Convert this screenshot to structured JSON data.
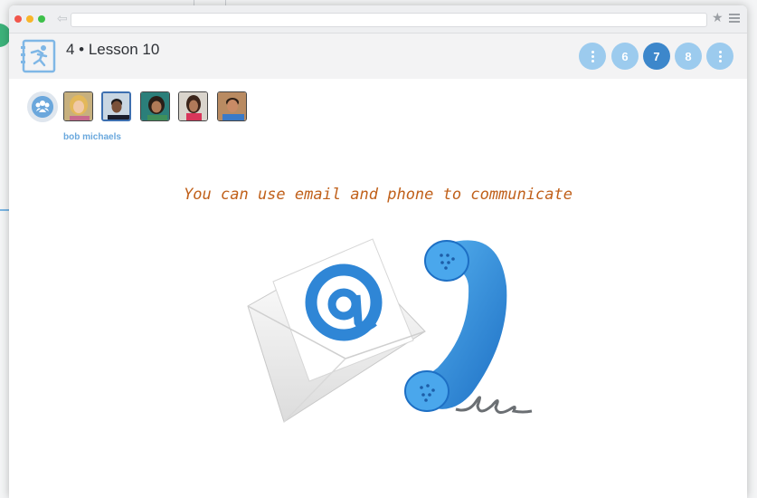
{
  "header": {
    "lesson_title": "4 • Lesson 10",
    "pages": [
      {
        "label": "",
        "type": "more"
      },
      {
        "label": "6",
        "type": "page"
      },
      {
        "label": "7",
        "type": "page",
        "active": true
      },
      {
        "label": "8",
        "type": "page"
      },
      {
        "label": "",
        "type": "more"
      }
    ]
  },
  "students": {
    "selected_name": "bob michaels",
    "avatars": [
      "girl-blonde",
      "boy-dark",
      "girl-dark",
      "girl-red-shirt",
      "boy-blue-shirt"
    ]
  },
  "lesson": {
    "caption": "You can use email and phone to communicate"
  },
  "colors": {
    "accent": "#3d87cb",
    "page_button": "#9ccbee",
    "caption": "#c0601a",
    "name": "#6aa8dd"
  }
}
